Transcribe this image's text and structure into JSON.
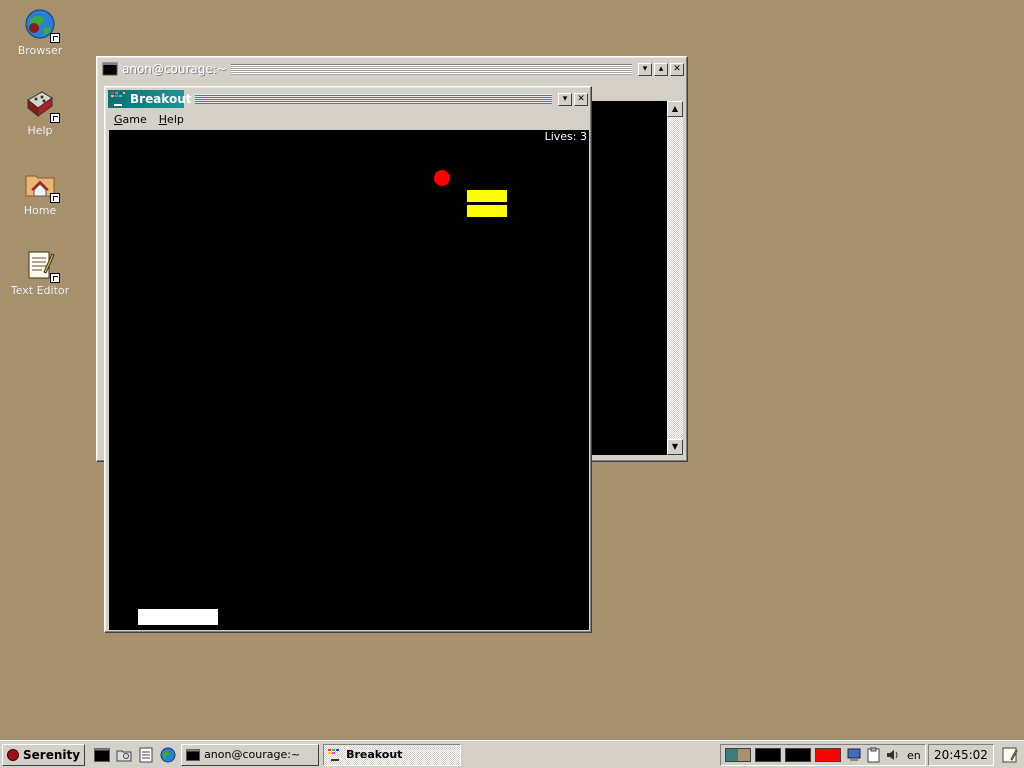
{
  "desktop": {
    "icons": [
      {
        "label": "Browser",
        "icon": "globe-icon"
      },
      {
        "label": "Help",
        "icon": "book-icon"
      },
      {
        "label": "Home",
        "icon": "folder-home-icon"
      },
      {
        "label": "Text Editor",
        "icon": "notepad-icon"
      }
    ]
  },
  "terminal_window": {
    "title": "anon@courage:~"
  },
  "breakout_window": {
    "title": "Breakout",
    "menu": [
      {
        "label": "Game",
        "accel": "G"
      },
      {
        "label": "Help",
        "accel": "H"
      }
    ],
    "lives_text": "Lives: 3",
    "colors": {
      "brick": "#ffff00",
      "ball": "#ff0000",
      "paddle": "#ffffff",
      "background": "#000000"
    }
  },
  "taskbar": {
    "start_label": "Serenity",
    "quick_launch": [
      "terminal-icon",
      "file-manager-icon",
      "text-editor-icon",
      "browser-icon"
    ],
    "tasks": [
      {
        "label": "anon@courage:~",
        "active": false
      },
      {
        "label": "Breakout",
        "active": true
      }
    ],
    "tray": {
      "workspaces": [
        "#3a7d7d",
        "#000000",
        "#000000",
        "#ff0000"
      ],
      "keyboard_layout": "en",
      "clock": "20:45:02"
    }
  }
}
